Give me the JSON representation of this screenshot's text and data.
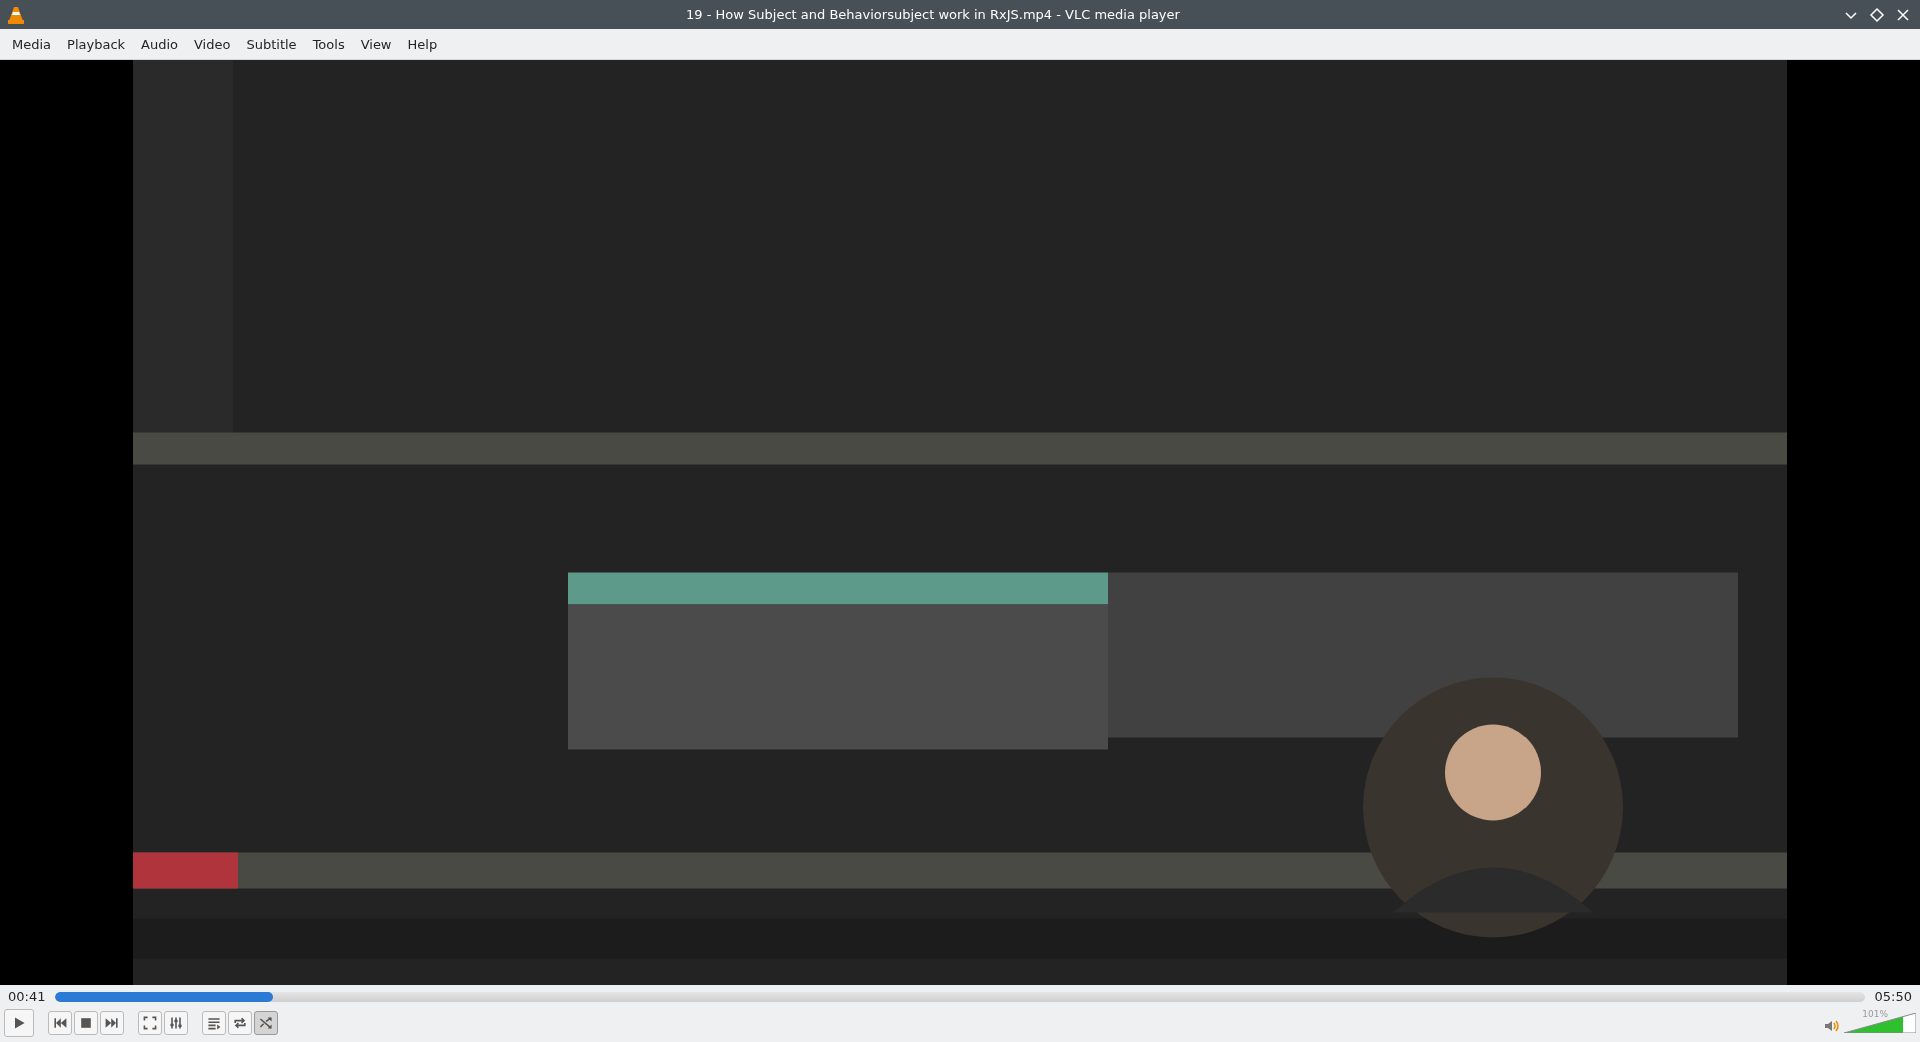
{
  "window": {
    "title": "19 - How Subject and Behaviorsubject work in RxJS.mp4 - VLC media player"
  },
  "menu": [
    "Media",
    "Playback",
    "Audio",
    "Video",
    "Subtitle",
    "Tools",
    "View",
    "Help"
  ],
  "video": {
    "kind": "picture"
  },
  "seek": {
    "elapsed": "00:41",
    "total": "05:50",
    "level": 0.12
  },
  "controls": [
    {
      "kind": "play",
      "on": false
    },
    {
      "kind": "prev",
      "on": false
    },
    {
      "kind": "stop",
      "on": false
    },
    {
      "kind": "next",
      "on": false
    },
    {
      "kind": "fullscreen",
      "on": false
    },
    {
      "kind": "settings",
      "on": false
    },
    {
      "kind": "playlist",
      "on": false
    },
    {
      "kind": "loop",
      "on": false
    },
    {
      "kind": "shuffle",
      "on": true
    }
  ],
  "volume": {
    "reading": "101%",
    "level": 0.82
  }
}
